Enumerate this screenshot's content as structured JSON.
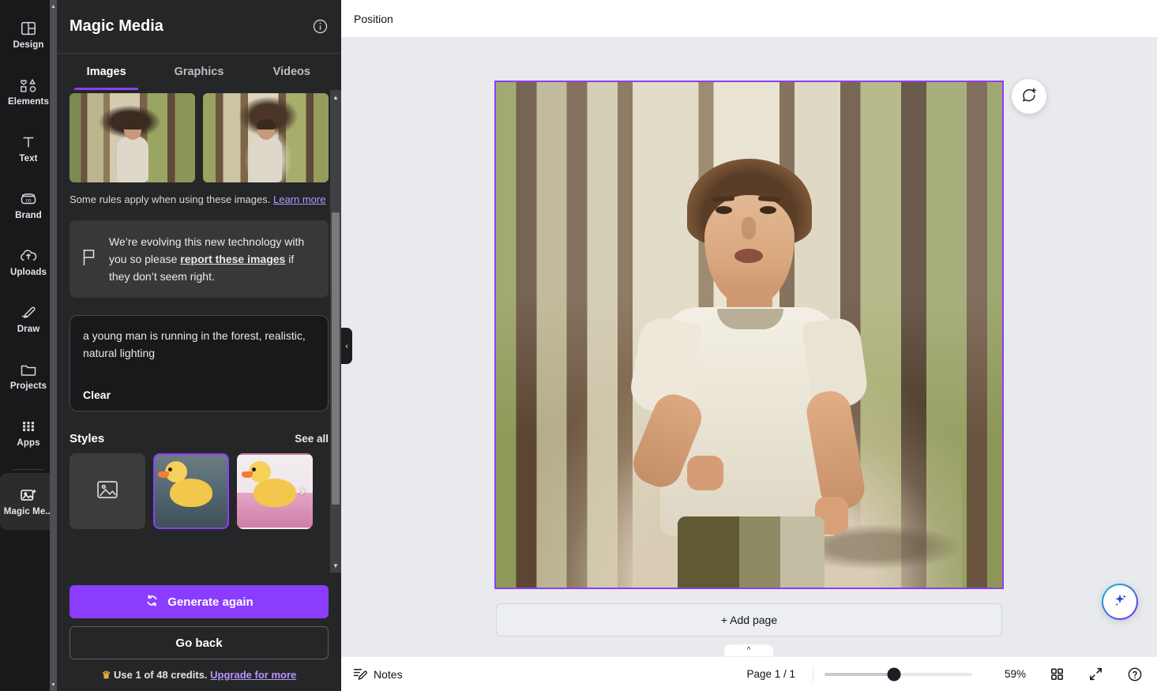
{
  "rail": {
    "items": [
      {
        "label": "Design",
        "icon": "layout-icon",
        "active": false
      },
      {
        "label": "Elements",
        "icon": "shapes-icon",
        "active": false
      },
      {
        "label": "Text",
        "icon": "text-icon",
        "active": false
      },
      {
        "label": "Brand",
        "icon": "brand-icon",
        "active": false
      },
      {
        "label": "Uploads",
        "icon": "upload-cloud-icon",
        "active": false
      },
      {
        "label": "Draw",
        "icon": "pencil-icon",
        "active": false
      },
      {
        "label": "Projects",
        "icon": "folder-icon",
        "active": false
      },
      {
        "label": "Apps",
        "icon": "grid-dots-icon",
        "active": false
      },
      {
        "label": "Magic Me...",
        "icon": "magic-media-icon",
        "active": true
      }
    ]
  },
  "panel": {
    "title": "Magic Media",
    "info_icon": "info-circle-icon",
    "tabs": [
      {
        "label": "Images",
        "active": true
      },
      {
        "label": "Graphics",
        "active": false
      },
      {
        "label": "Videos",
        "active": false
      }
    ],
    "results": [
      {
        "alt": "man running forest result 1"
      },
      {
        "alt": "man running forest result 2"
      }
    ],
    "rules_text": "Some rules apply when using these images. ",
    "rules_link": "Learn more",
    "notice": {
      "icon": "flag-icon",
      "before": "We’re evolving this new technology with you so please ",
      "bold": "report these images",
      "after": " if they don’t seem right."
    },
    "prompt": {
      "value": "a young man is running in the forest, realistic, natural lighting",
      "clear_label": "Clear"
    },
    "styles": {
      "title": "Styles",
      "see_all": "See all",
      "items": [
        {
          "name": "none",
          "selected": false
        },
        {
          "name": "photo-duck-water",
          "selected": true
        },
        {
          "name": "photo-duck-pink",
          "selected": false
        }
      ],
      "next_icon": "chevron-right-icon"
    },
    "generate_label": "Generate again",
    "generate_icon": "refresh-icon",
    "go_back_label": "Go back",
    "credits": {
      "crown": "♛",
      "text": "Use 1 of 48 credits. ",
      "link": "Upgrade for more"
    },
    "collapse_icon": "chevron-left-icon"
  },
  "topbar": {
    "position_label": "Position"
  },
  "canvas": {
    "object_tools": [
      {
        "name": "lock",
        "icon": "unlock-icon"
      },
      {
        "name": "duplicate",
        "icon": "duplicate-icon"
      },
      {
        "name": "add-to-page",
        "icon": "add-page-icon"
      }
    ],
    "comment_button": "comment-add-icon",
    "magic_button": "magic-sparkle-icon",
    "add_page_label": "+ Add page",
    "panel_toggle_icon": "chevron-up-icon",
    "selection_color": "#8b3dff"
  },
  "bottombar": {
    "notes_label": "Notes",
    "notes_icon": "notes-icon",
    "page_label": "Page 1 / 1",
    "zoom_value": "59%",
    "zoom_percent": 47,
    "grid_icon": "grid-view-icon",
    "fullscreen_icon": "expand-icon",
    "help_icon": "help-circle-icon"
  },
  "colors": {
    "accent": "#8b3dff",
    "panel_bg": "#252627",
    "rail_bg": "#18191b",
    "canvas_bg": "#e9eaee"
  }
}
